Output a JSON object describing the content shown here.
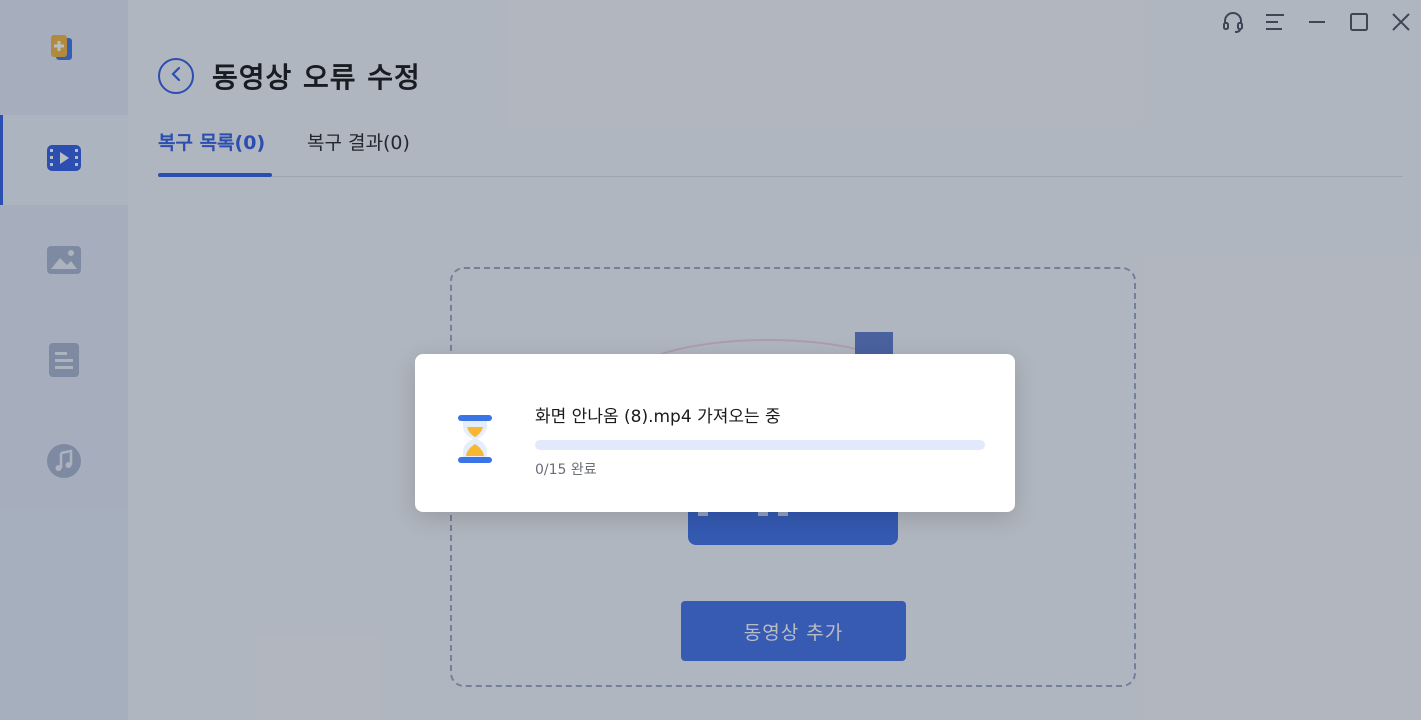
{
  "header": {
    "title": "동영상 오류 수정"
  },
  "tabs": [
    {
      "label": "복구 목록(0)",
      "active": true
    },
    {
      "label": "복구 결과(0)",
      "active": false
    }
  ],
  "sidebar": {
    "items": [
      {
        "icon": "video-icon",
        "active": true
      },
      {
        "icon": "photo-icon",
        "active": false
      },
      {
        "icon": "document-icon",
        "active": false
      },
      {
        "icon": "audio-icon",
        "active": false
      }
    ]
  },
  "window_controls": [
    "support-icon",
    "menu-icon",
    "minimize-icon",
    "maximize-icon",
    "close-icon"
  ],
  "main": {
    "add_button": "동영상 추가"
  },
  "modal": {
    "message": "화면 안나옴 (8).mp4 가져오는 중",
    "progress_label": "0/15 완료",
    "progress_value": 0
  },
  "colors": {
    "accent": "#2d5be3",
    "button": "#3f6de8",
    "progress_track": "#e2e9fb"
  }
}
